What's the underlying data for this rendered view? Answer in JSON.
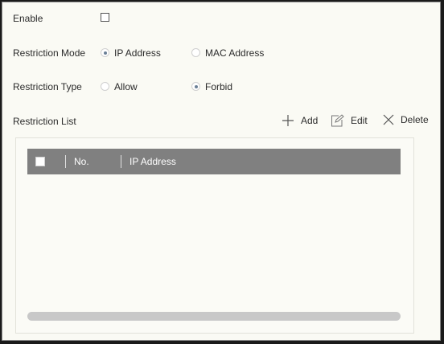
{
  "form": {
    "enable_label": "Enable",
    "enable_checked": false,
    "restriction_mode": {
      "label": "Restriction Mode",
      "options": [
        "IP Address",
        "MAC Address"
      ],
      "selected": "IP Address"
    },
    "restriction_type": {
      "label": "Restriction Type",
      "options": [
        "Allow",
        "Forbid"
      ],
      "selected": "Forbid"
    }
  },
  "list": {
    "label": "Restriction List",
    "toolbar": {
      "add_label": "Add",
      "edit_label": "Edit",
      "delete_label": "Delete"
    },
    "columns": [
      "No.",
      "IP Address"
    ],
    "rows": []
  },
  "colors": {
    "panel_bg": "#fafaf4",
    "table_header": "#808080",
    "radio_dot": "#6a7f96"
  }
}
